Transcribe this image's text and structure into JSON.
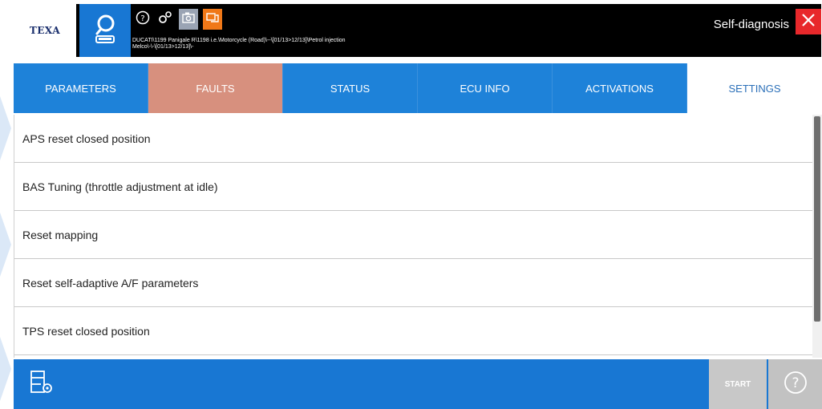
{
  "header": {
    "logo_text": "TEXA",
    "vehicle_path_line1": "DUCATI\\1199 Panigale R\\1198 i.e.\\Motorcycle (Road)\\--\\[01/13>12/13]\\Petrol injection",
    "vehicle_path_line2": "Melco\\-\\-\\[01/13>12/13]\\-",
    "mode_title": "Self-diagnosis",
    "icons": [
      "search-car-icon",
      "help-icon",
      "settings-icon",
      "camera-icon",
      "vci-icon",
      "close-icon"
    ],
    "colors": {
      "bar": "#000000",
      "search": "#1877d3",
      "camera": "#9aa4b4",
      "vci": "#f07818",
      "close": "#e8282b"
    }
  },
  "tabs": [
    {
      "label": "PARAMETERS"
    },
    {
      "label": "FAULTS"
    },
    {
      "label": "STATUS"
    },
    {
      "label": "ECU INFO"
    },
    {
      "label": "ACTIVATIONS"
    },
    {
      "label": "SETTINGS"
    }
  ],
  "tab_colors": {
    "default": "#1e82d9",
    "faults": "#d7907e",
    "selected": "#ffffff"
  },
  "items": [
    {
      "label": "APS reset closed position"
    },
    {
      "label": "BAS Tuning (throttle adjustment at idle)"
    },
    {
      "label": "Reset mapping"
    },
    {
      "label": "Reset self-adaptive A/F parameters"
    },
    {
      "label": "TPS reset closed position"
    }
  ],
  "footer": {
    "start_label": "START",
    "icons": [
      "list-settings-icon",
      "help-icon"
    ],
    "colors": {
      "bar": "#1877d3",
      "disabled": "#c8c8c8"
    }
  }
}
